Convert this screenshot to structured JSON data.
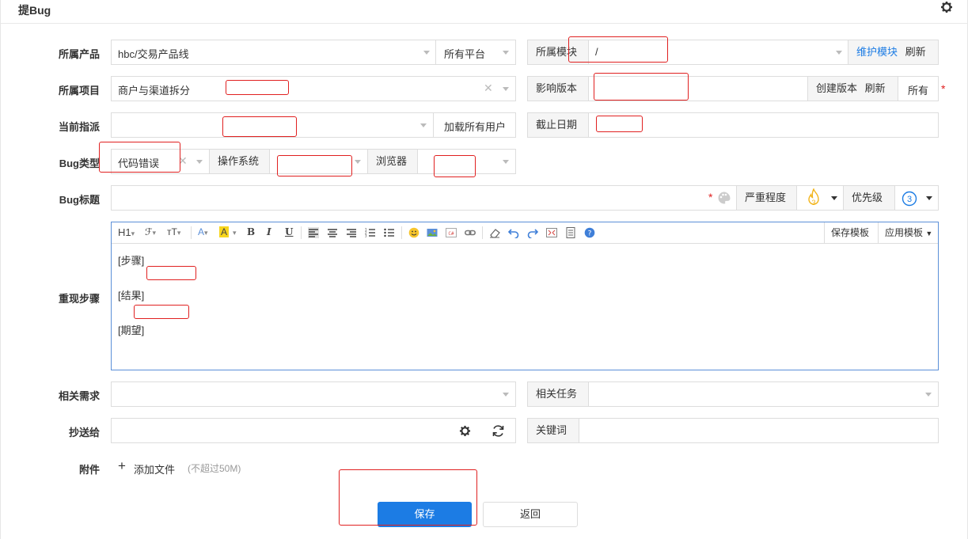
{
  "header": {
    "title": "提Bug",
    "settings_icon": "gear-icon"
  },
  "labels": {
    "product": "所属产品",
    "project": "所属项目",
    "assign": "当前指派",
    "bug_type": "Bug类型",
    "bug_title": "Bug标题",
    "steps": "重现步骤",
    "story": "相关需求",
    "cc": "抄送给",
    "attachment": "附件"
  },
  "product": {
    "value": "hbc/交易产品线",
    "platform": "所有平台"
  },
  "module": {
    "addon": "所属模块",
    "value": "/",
    "maintain": "维护模块",
    "refresh": "刷新"
  },
  "project": {
    "value": "商户与渠道拆分"
  },
  "build": {
    "addon": "影响版本",
    "create": "创建版本",
    "refresh": "刷新",
    "all": "所有"
  },
  "assign": {
    "load_all": "加载所有用户"
  },
  "deadline": {
    "addon": "截止日期"
  },
  "type": {
    "value": "代码错误",
    "os_addon": "操作系统",
    "browser_addon": "浏览器"
  },
  "title": {
    "severity_addon": "严重程度",
    "severity_value": "3",
    "priority_addon": "优先级",
    "priority_value": "3"
  },
  "editor": {
    "toolbar": {
      "heading": "H1",
      "font": "ℱ",
      "size": "тT",
      "font_color": "A",
      "bg_color": "A",
      "bold": "B",
      "italic": "I",
      "underline": "U",
      "save_template": "保存模板",
      "apply_template": "应用模板"
    },
    "lines": [
      "[步骤]",
      "[结果]",
      "[期望]"
    ]
  },
  "task": {
    "addon": "相关任务"
  },
  "keywords": {
    "addon": "关键词"
  },
  "attachment": {
    "add": "添加文件",
    "hint": "(不超过50M)"
  },
  "buttons": {
    "save": "保存",
    "back": "返回"
  },
  "colors": {
    "primary": "#1c7ce4",
    "required": "#e02020",
    "annotation": "#e02020"
  }
}
